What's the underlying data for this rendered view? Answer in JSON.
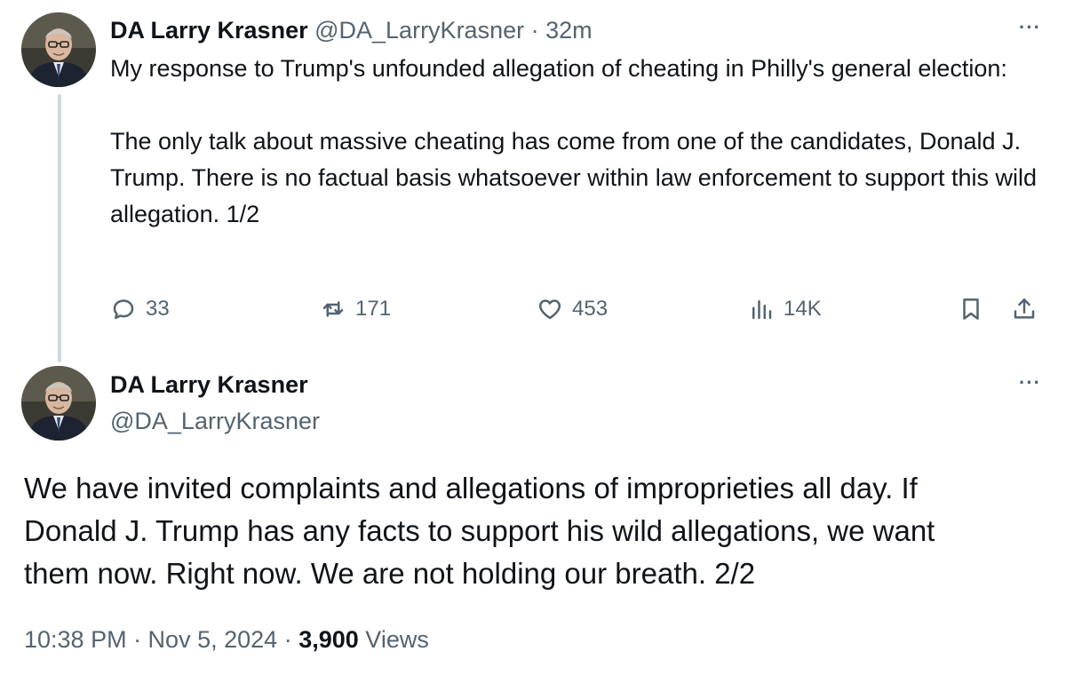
{
  "tweet1": {
    "display_name": "DA Larry Krasner",
    "handle": "@DA_LarryKrasner",
    "separator": "·",
    "time": "32m",
    "more_label": "···",
    "paragraphs": [
      "My response to Trump's unfounded allegation of cheating in Philly's general election:",
      "The only talk about massive cheating has come from one of the candidates, Donald J. Trump. There is no factual basis whatsoever within law enforcement to support this wild allegation. 1/2"
    ],
    "actions": {
      "replies": "33",
      "retweets": "171",
      "likes": "453",
      "views": "14K"
    },
    "icons": [
      "reply-icon",
      "retweet-icon",
      "like-icon",
      "views-icon",
      "bookmark-icon",
      "share-icon"
    ]
  },
  "tweet2": {
    "display_name": "DA Larry Krasner",
    "handle": "@DA_LarryKrasner",
    "more_label": "···",
    "lines": [
      "We have invited complaints and allegations of improprieties all day. If",
      "Donald J. Trump has any facts to support his wild allegations, we want",
      "them now. Right now. We are not holding our breath. 2/2"
    ],
    "timestamp": "10:38 PM · Nov 5, 2024",
    "separator": "·",
    "views_count": "3,900",
    "views_label": "Views"
  },
  "colors": {
    "text_primary": "#0f1419",
    "text_secondary": "#536471",
    "thread_line": "#cfd9de",
    "background": "#ffffff"
  }
}
